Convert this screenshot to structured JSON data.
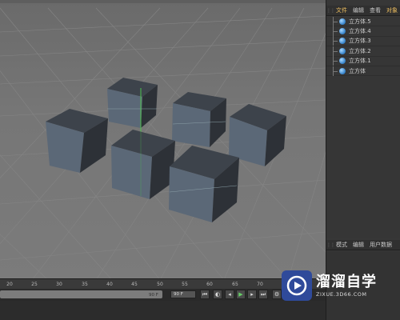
{
  "object_manager": {
    "menu": [
      "文件",
      "编辑",
      "查看",
      "对象"
    ],
    "objects": [
      "立方体.5",
      "立方体.4",
      "立方体.3",
      "立方体.2",
      "立方体.1",
      "立方体"
    ]
  },
  "attribute_manager": {
    "menu": [
      "模式",
      "编辑",
      "用户数据"
    ]
  },
  "timeline": {
    "ticks": [
      "20",
      "25",
      "30",
      "35",
      "40",
      "45",
      "50",
      "55",
      "60",
      "65",
      "70"
    ],
    "range_end": "90 F",
    "frame_field": "90 F"
  },
  "watermark": {
    "name": "溜溜自学",
    "url": "ZIXUE.3D66.COM"
  },
  "colors": {
    "viewport_bg": "#747474",
    "cube_face": "#5a6878",
    "cube_top": "#3f464f",
    "panel_bg": "#373737",
    "accent": "#f0c060"
  },
  "icons": {
    "object": "cube-object-icon",
    "transport": [
      "goto-start-icon",
      "prev-key-icon",
      "play-icon",
      "next-key-icon",
      "goto-end-icon"
    ]
  }
}
